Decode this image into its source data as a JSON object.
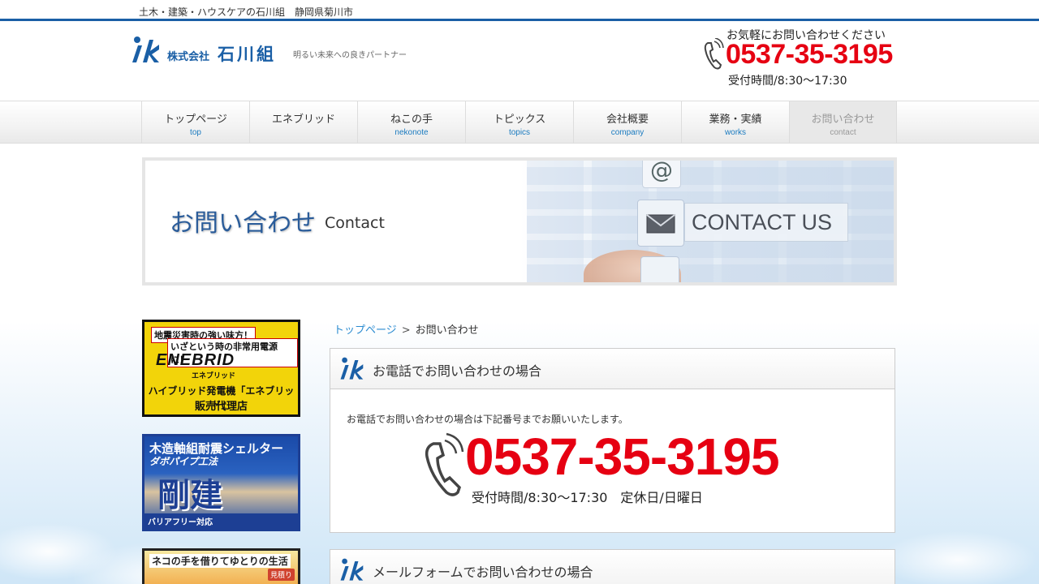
{
  "topbar": {
    "tagline": "土木・建築・ハウスケアの石川組　静岡県菊川市"
  },
  "header": {
    "company_prefix": "株式会社",
    "company_name": "石川組",
    "slogan": "明るい未来への良きパートナー",
    "contact_lead": "お気軽にお問い合わせください",
    "phone": "0537-35-3195",
    "hours": "受付時間/8:30〜17:30"
  },
  "nav": {
    "items": [
      {
        "jp": "トップページ",
        "en": "top"
      },
      {
        "jp": "エネブリッド",
        "en": ""
      },
      {
        "jp": "ねこの手",
        "en": "nekonote"
      },
      {
        "jp": "トピックス",
        "en": "topics"
      },
      {
        "jp": "会社概要",
        "en": "company"
      },
      {
        "jp": "業務・実績",
        "en": "works"
      },
      {
        "jp": "お問い合わせ",
        "en": "contact"
      }
    ],
    "active_index": 6
  },
  "banner": {
    "title": "お問い合わせ",
    "subtitle": "Contact",
    "contact_us": "CONTACT US",
    "at_symbol": "@"
  },
  "sidebar": {
    "enebrid": {
      "line1": "地震災害時の強い味方！",
      "line2": "いざという時の非常用電源に！",
      "brand": "ENEBRID",
      "brand_kana": "エネブリッド",
      "line3": "ハイブリッド発電機「エネブリッド」",
      "line4": "販売代理店"
    },
    "shelter": {
      "line1": "木造軸組耐震シェルター",
      "line2": "ダボパイプ工法",
      "big": "剛建",
      "line3": "バリアフリー対応"
    },
    "nekonote": {
      "line1": "ネコの手を借りてゆとりの生活",
      "badge": "見積り"
    }
  },
  "breadcrumb": {
    "home": "トップページ",
    "separator": ">",
    "current": "お問い合わせ"
  },
  "phone_section": {
    "title": "お電話でお問い合わせの場合",
    "lead": "お電話でお問い合わせの場合は下記番号までお願いいたします。",
    "phone": "0537-35-3195",
    "hours": "受付時間/8:30〜17:30　定休日/日曜日"
  },
  "mail_section": {
    "title": "メールフォームでお問い合わせの場合"
  },
  "colors": {
    "brand_blue": "#1a5fa6",
    "phone_red": "#e60012",
    "link_blue": "#2a8bd0"
  }
}
